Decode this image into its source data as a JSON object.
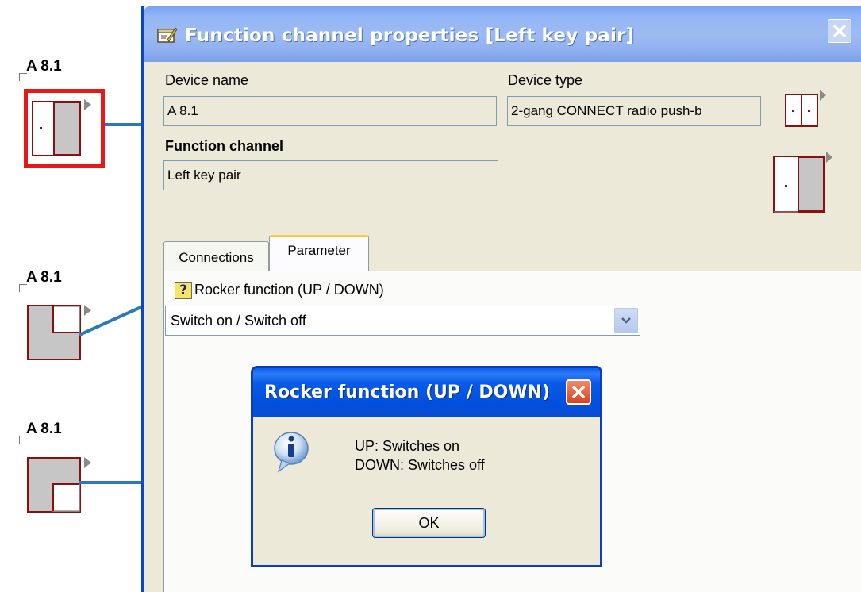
{
  "left_devices": [
    {
      "label": "A 8.1"
    },
    {
      "label": "A 8.1"
    },
    {
      "label": "A 8.1"
    }
  ],
  "window": {
    "title": "Function channel properties [Left key pair]",
    "device_name_label": "Device name",
    "device_name_value": "A 8.1",
    "device_type_label": "Device type",
    "device_type_value": "2-gang CONNECT radio push-b",
    "function_channel_label": "Function channel",
    "function_channel_value": "Left key pair",
    "tabs": [
      {
        "label": "Connections",
        "active": false
      },
      {
        "label": "Parameter",
        "active": true
      }
    ],
    "parameter": {
      "help_glyph": "?",
      "label": "Rocker function (UP / DOWN)",
      "selected": "Switch on / Switch off"
    }
  },
  "message_box": {
    "title": "Rocker function (UP / DOWN)",
    "icon": "info-icon",
    "line1": "UP: Switches on",
    "line2": "DOWN: Switches off",
    "ok_label": "OK"
  },
  "colors": {
    "selection_frame": "#e81818",
    "wire": "#2a7ab8",
    "device_border": "#8a1010"
  }
}
